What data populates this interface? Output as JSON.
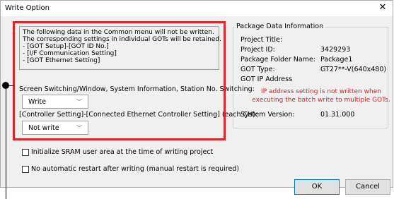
{
  "window": {
    "title": "Write Option"
  },
  "info": {
    "lines": [
      "The following data in the Common menu will not be written.",
      "The corresponding settings in individual GOTs will be retained.",
      "- [GOT Setup]-[GOT ID No.]",
      "- [I/F Communication Setting]",
      "- [GOT Ethernet Setting]"
    ]
  },
  "screen_switching": {
    "label": "Screen Switching/Window, System Information, Station No. Switching:",
    "value": "Write"
  },
  "controller_setting": {
    "label": "[Controller Setting]-[Connected Ethernet Controller Setting] (each CH):",
    "value": "Not write"
  },
  "package": {
    "group_title": "Package Data Information",
    "project_title_label": "Project Title:",
    "project_title_value": "",
    "project_id_label": "Project ID:",
    "project_id_value": "3429293",
    "folder_name_label": "Package Folder Name:",
    "folder_name_value": "Package1",
    "got_type_label": "GOT Type:",
    "got_type_value": "GT27**-V(640x480)",
    "got_ip_label": "GOT IP Address",
    "warning_line1": "IP address setting is not written when",
    "warning_line2": "executing the batch write to multiple GOTs.",
    "system_version_label": "System Version:",
    "system_version_value": "01.31.000"
  },
  "options": {
    "sram_label": "Initialize SRAM user area at the time of writing project",
    "sram_checked": false,
    "restart_label": "No automatic restart after writing (manual restart is required)",
    "restart_checked": false
  },
  "buttons": {
    "ok": "OK",
    "cancel": "Cancel"
  },
  "colors": {
    "highlight": "#d9262c",
    "warning": "#e02020",
    "accent": "#0078d7"
  },
  "icons": {
    "close": "close-icon",
    "dropdown": "chevron-down-icon"
  }
}
